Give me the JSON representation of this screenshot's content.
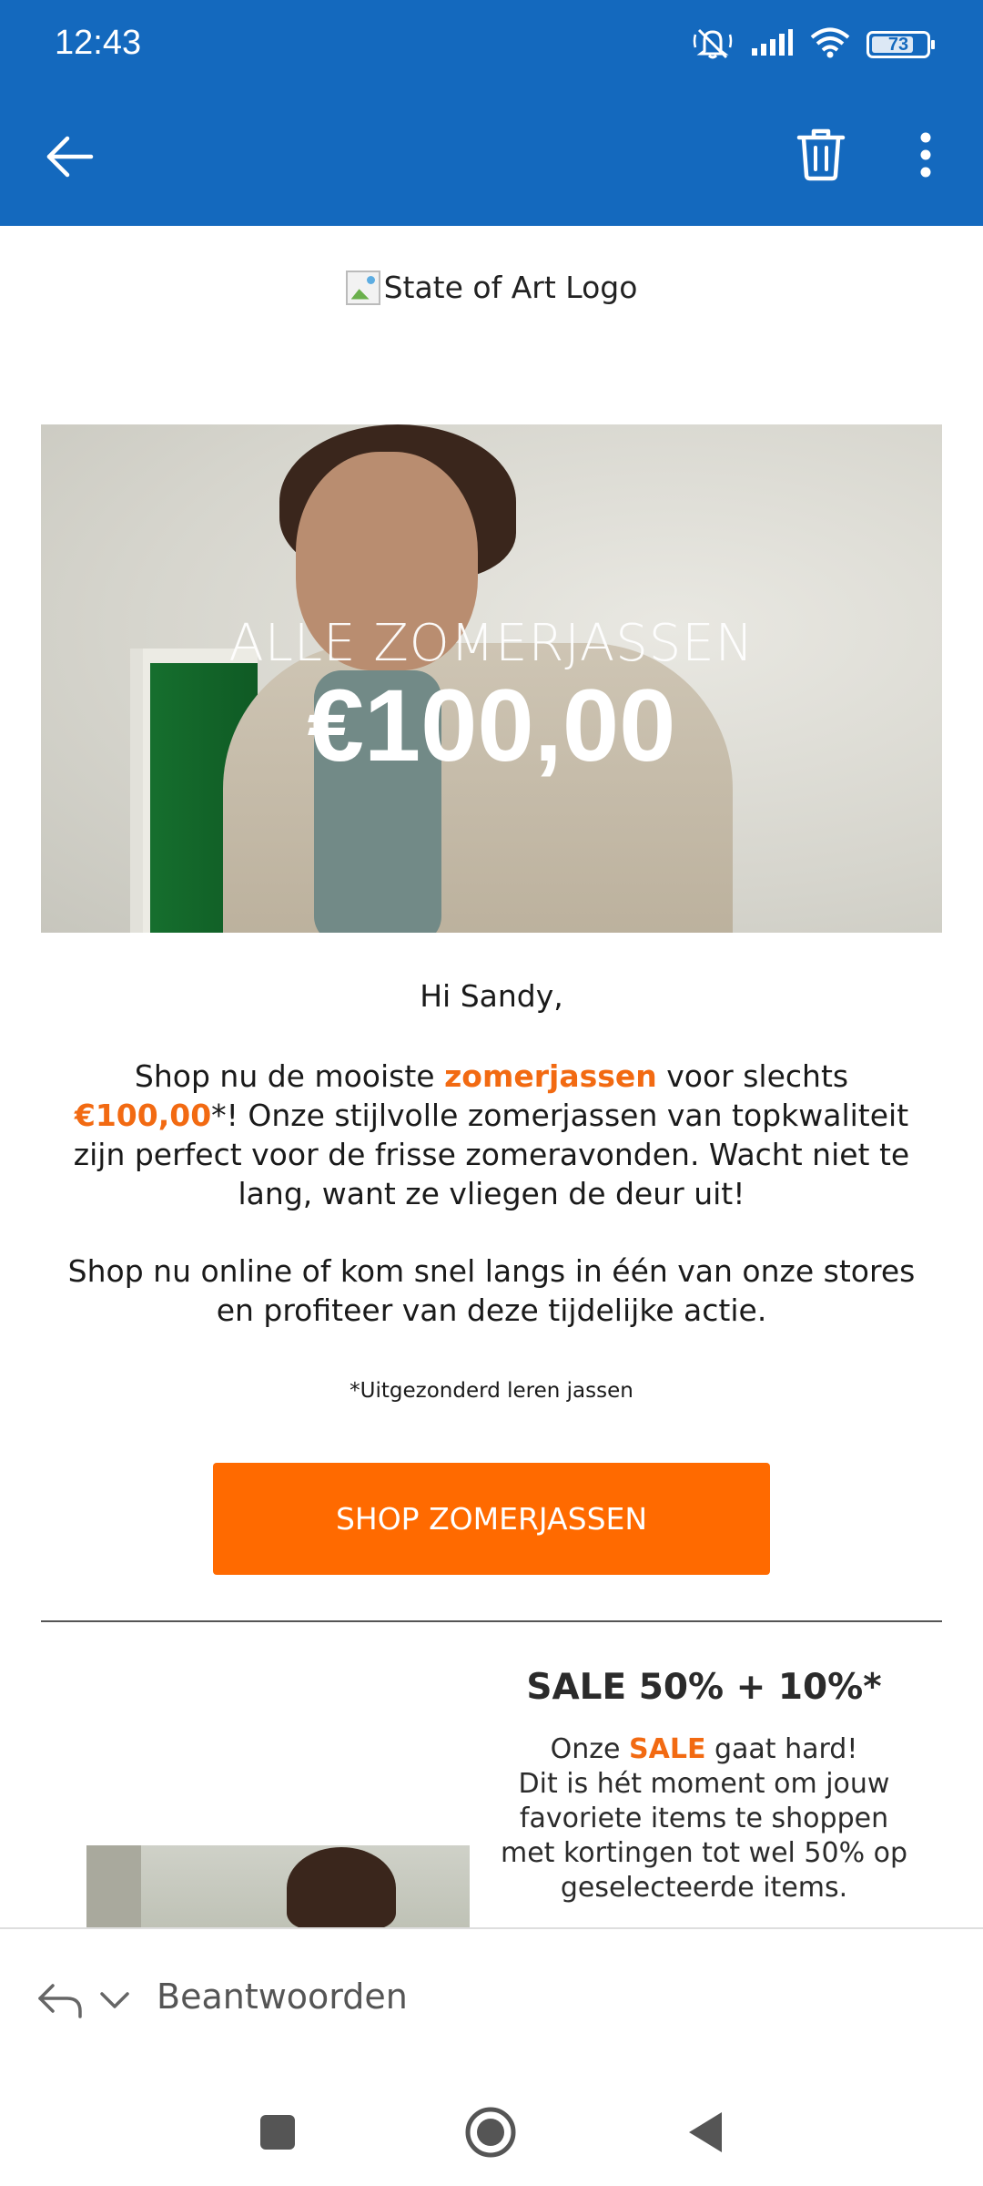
{
  "status_bar": {
    "time": "12:43",
    "battery": "73",
    "icons": [
      "mute-icon",
      "signal-icon",
      "wifi-icon",
      "battery-icon"
    ]
  },
  "app_bar": {
    "icons": [
      "back-arrow-icon",
      "trash-icon",
      "more-vert-icon"
    ],
    "color": "#1469be"
  },
  "email": {
    "logo_alt": "State of Art Logo",
    "hero": {
      "subtitle": "ALLE ZOMERJASSEN",
      "price": "€100,00"
    },
    "greeting": "Hi Sandy,",
    "para1": {
      "t1": "Shop nu de mooiste ",
      "h1": "zomerjassen",
      "t2": " voor slechts ",
      "h2": "€100,00",
      "t3": "*! Onze stijlvolle zomerjassen van topkwaliteit zijn perfect voor de frisse zomeravonden. Wacht niet te lang, want ze vliegen de deur uit!"
    },
    "para2": "Shop nu online of kom snel langs in één van onze stores en profiteer van deze tijdelijke actie.",
    "note": "*Uitgezonderd leren jassen",
    "cta_label": "SHOP ZOMERJASSEN",
    "accent_color": "#ff6a00",
    "sale": {
      "title": "SALE 50% + 10%*",
      "b1": "Onze ",
      "h1": "SALE",
      "b2": " gaat hard!",
      "b3": "Dit is hét moment om jouw favoriete items te shoppen met kortingen tot wel 50% op geselecteerde items."
    }
  },
  "reply_bar": {
    "label": "Beantwoorden"
  },
  "nav_bar": {
    "icons": [
      "recents-square-icon",
      "home-circle-icon",
      "back-triangle-icon"
    ]
  }
}
